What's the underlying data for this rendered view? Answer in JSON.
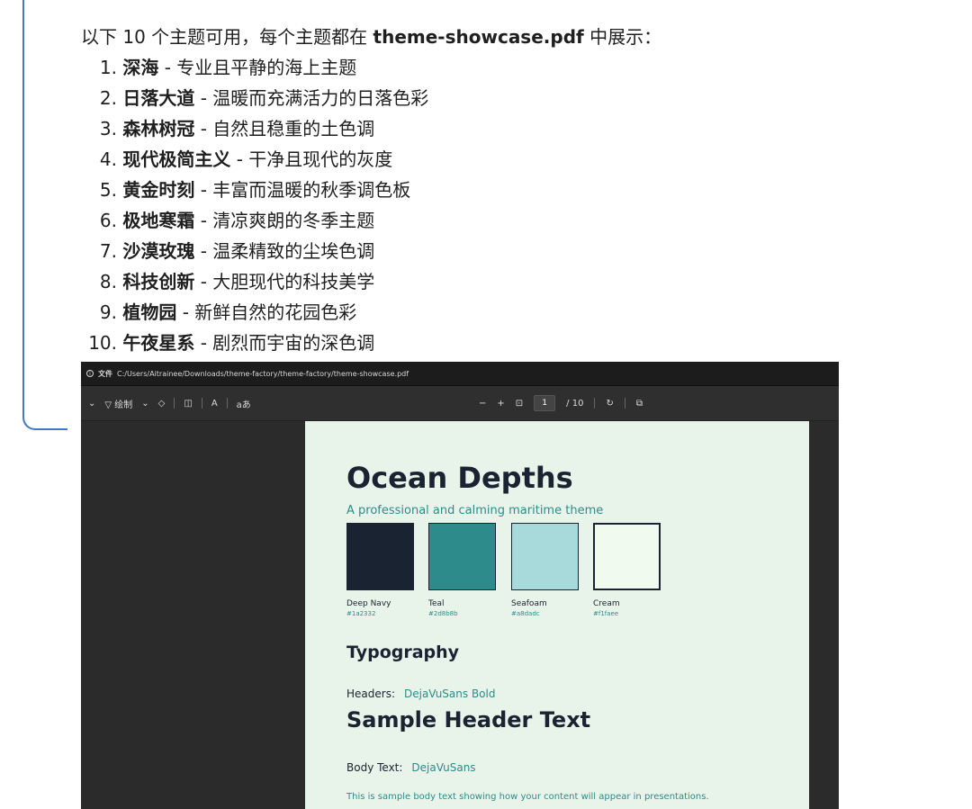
{
  "intro": {
    "prefix": "以下 10 个主题可用，每个主题都在 ",
    "filename": "theme-showcase.pdf",
    "suffix": " 中展示："
  },
  "themes": [
    {
      "num": "1.",
      "name": "深海",
      "desc": " - 专业且平静的海上主题"
    },
    {
      "num": "2.",
      "name": "日落大道",
      "desc": " - 温暖而充满活力的日落色彩"
    },
    {
      "num": "3.",
      "name": "森林树冠",
      "desc": " - 自然且稳重的土色调"
    },
    {
      "num": "4.",
      "name": "现代极简主义",
      "desc": " - 干净且现代的灰度"
    },
    {
      "num": "5.",
      "name": "黄金时刻",
      "desc": " - 丰富而温暖的秋季调色板"
    },
    {
      "num": "6.",
      "name": "极地寒霜",
      "desc": " - 清凉爽朗的冬季主题"
    },
    {
      "num": "7.",
      "name": "沙漠玫瑰",
      "desc": " - 温柔精致的尘埃色调"
    },
    {
      "num": "8.",
      "name": "科技创新",
      "desc": " - 大胆现代的科技美学"
    },
    {
      "num": "9.",
      "name": "植物园",
      "desc": " - 新鲜自然的花园色彩"
    },
    {
      "num": "10.",
      "name": "午夜星系",
      "desc": " - 剧烈而宇宙的深色调"
    }
  ],
  "viewer": {
    "address": {
      "label": "文件",
      "path": "C:/Users/Aitrainee/Downloads/theme-factory/theme-factory/theme-showcase.pdf"
    },
    "toolbar": {
      "draw_label": "绘制",
      "text_icon": "A",
      "read_aloud": "aあ",
      "zoom_out": "−",
      "zoom_in": "+",
      "page_current": "1",
      "page_total": "/ 10"
    },
    "page": {
      "title": "Ocean Depths",
      "subtitle": "A professional and calming maritime theme",
      "swatches": [
        {
          "name": "Deep Navy",
          "hex": "#1a2332"
        },
        {
          "name": "Teal",
          "hex": "#2d8b8b"
        },
        {
          "name": "Seafoam",
          "hex": "#a8dadc"
        },
        {
          "name": "Cream",
          "hex": "#f1faee"
        }
      ],
      "typography_heading": "Typography",
      "headers_label": "Headers:",
      "headers_value": "DejaVuSans Bold",
      "sample_header": "Sample Header Text",
      "body_label": "Body Text:",
      "body_value": "DejaVuSans",
      "body_sample": "This is sample body text showing how your content will appear in presentations."
    }
  },
  "colors": {
    "bracket": "#3f78c6",
    "viewer_bg": "#2b2b2b",
    "page_bg": "#e8f4e9"
  }
}
